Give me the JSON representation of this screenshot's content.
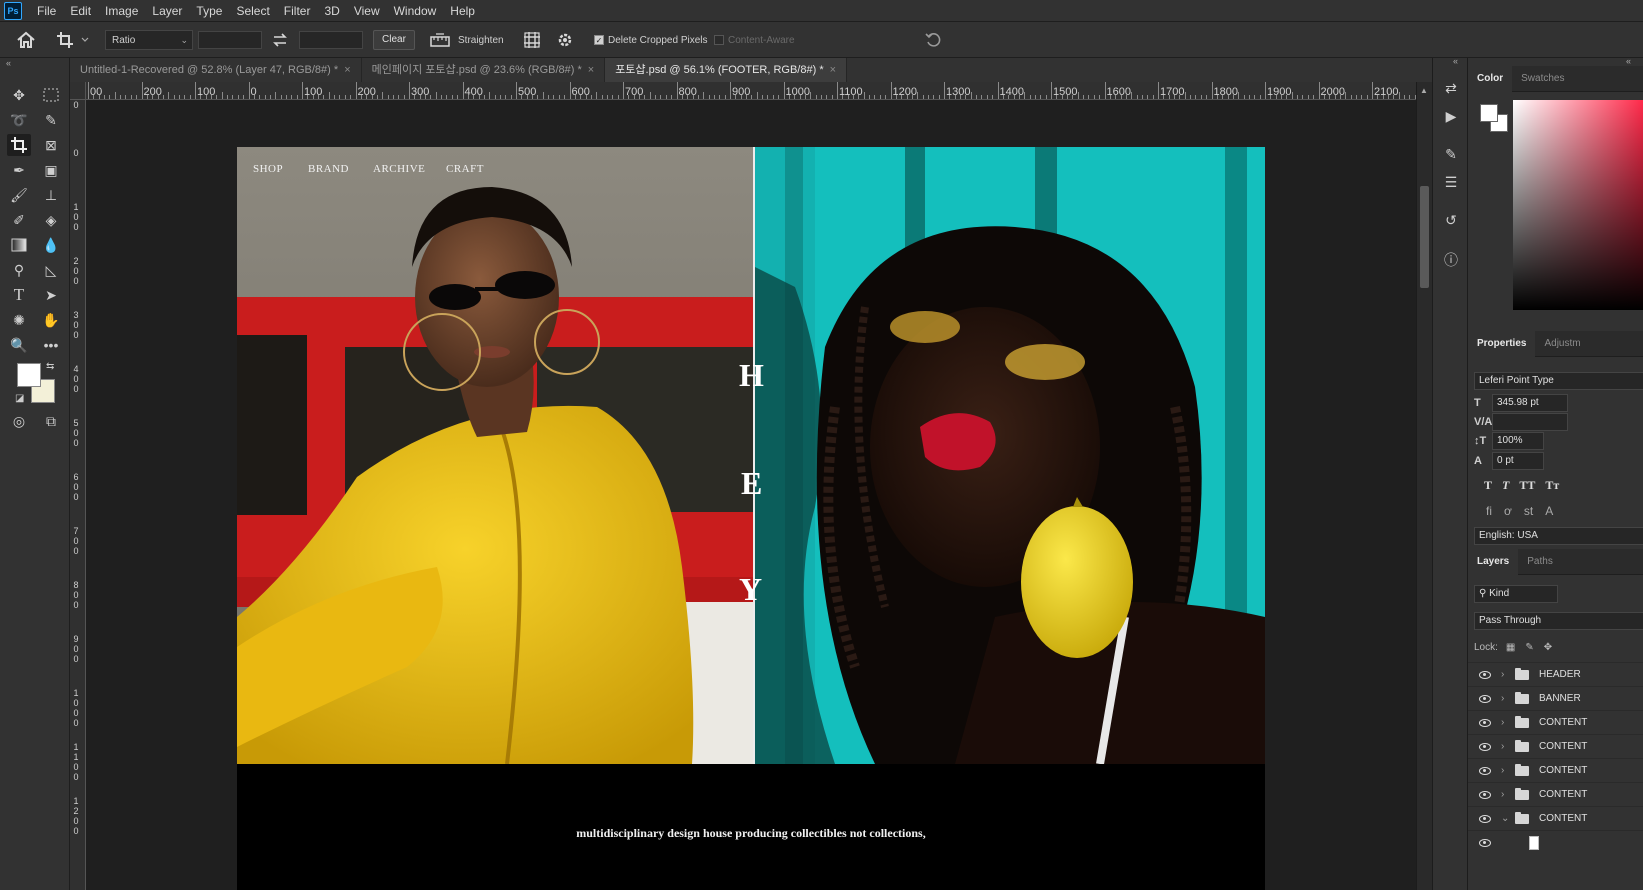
{
  "menubar": {
    "logo": "Ps",
    "items": [
      "File",
      "Edit",
      "Image",
      "Layer",
      "Type",
      "Select",
      "Filter",
      "3D",
      "View",
      "Window",
      "Help"
    ]
  },
  "options": {
    "ratio_label": "Ratio",
    "clear_label": "Clear",
    "straighten_label": "Straighten",
    "delete_cropped_label": "Delete Cropped Pixels",
    "content_aware_label": "Content-Aware"
  },
  "tabs": [
    {
      "label": "Untitled-1-Recovered @ 52.8% (Layer 47, RGB/8#) *",
      "active": false
    },
    {
      "label": "메인페이지 포토샵.psd @ 23.6% (RGB/8#) *",
      "active": false
    },
    {
      "label": "포토샵.psd @ 56.1% (FOOTER, RGB/8#) *",
      "active": true
    }
  ],
  "ruler_top": [
    "00",
    "200",
    "100",
    "0",
    "100",
    "200",
    "300",
    "400",
    "500",
    "600",
    "700",
    "800",
    "900",
    "1000",
    "1100",
    "1200",
    "1300",
    "1400",
    "1500",
    "1600",
    "1700",
    "1800",
    "1900",
    "2000",
    "2100"
  ],
  "ruler_left": [
    "0",
    "0",
    "100",
    "200",
    "300",
    "400",
    "500",
    "600",
    "700",
    "800",
    "900",
    "1000",
    "1100",
    "1200"
  ],
  "canvas": {
    "nav": [
      "SHOP",
      "BRAND",
      "ARCHIVE",
      "CRAFT"
    ],
    "letters": [
      "H",
      "E",
      "Y"
    ],
    "tagline": "multidisciplinary design house producing collectibles not collections,"
  },
  "panels": {
    "color_tabs": [
      "Color",
      "Swatches"
    ],
    "prop_tabs": [
      "Properties",
      "Adjustm"
    ],
    "font_name": "Leferi Point Type",
    "font_size": "345.98 pt",
    "leading": "100%",
    "baseline": "0 pt",
    "language": "English: USA",
    "layer_tabs": [
      "Layers",
      "Paths"
    ],
    "kind_label": "Kind",
    "blend_mode": "Pass Through",
    "lock_label": "Lock:",
    "layers": [
      "HEADER",
      "BANNER",
      "CONTENT",
      "CONTENT",
      "CONTENT",
      "CONTENT",
      "CONTENT"
    ]
  },
  "colors": {
    "bg": "#282828",
    "panel": "#323232",
    "accent_teal": "#14bfbd",
    "jacket_yellow": "#f2c21b",
    "window_red": "#d41e1e"
  }
}
